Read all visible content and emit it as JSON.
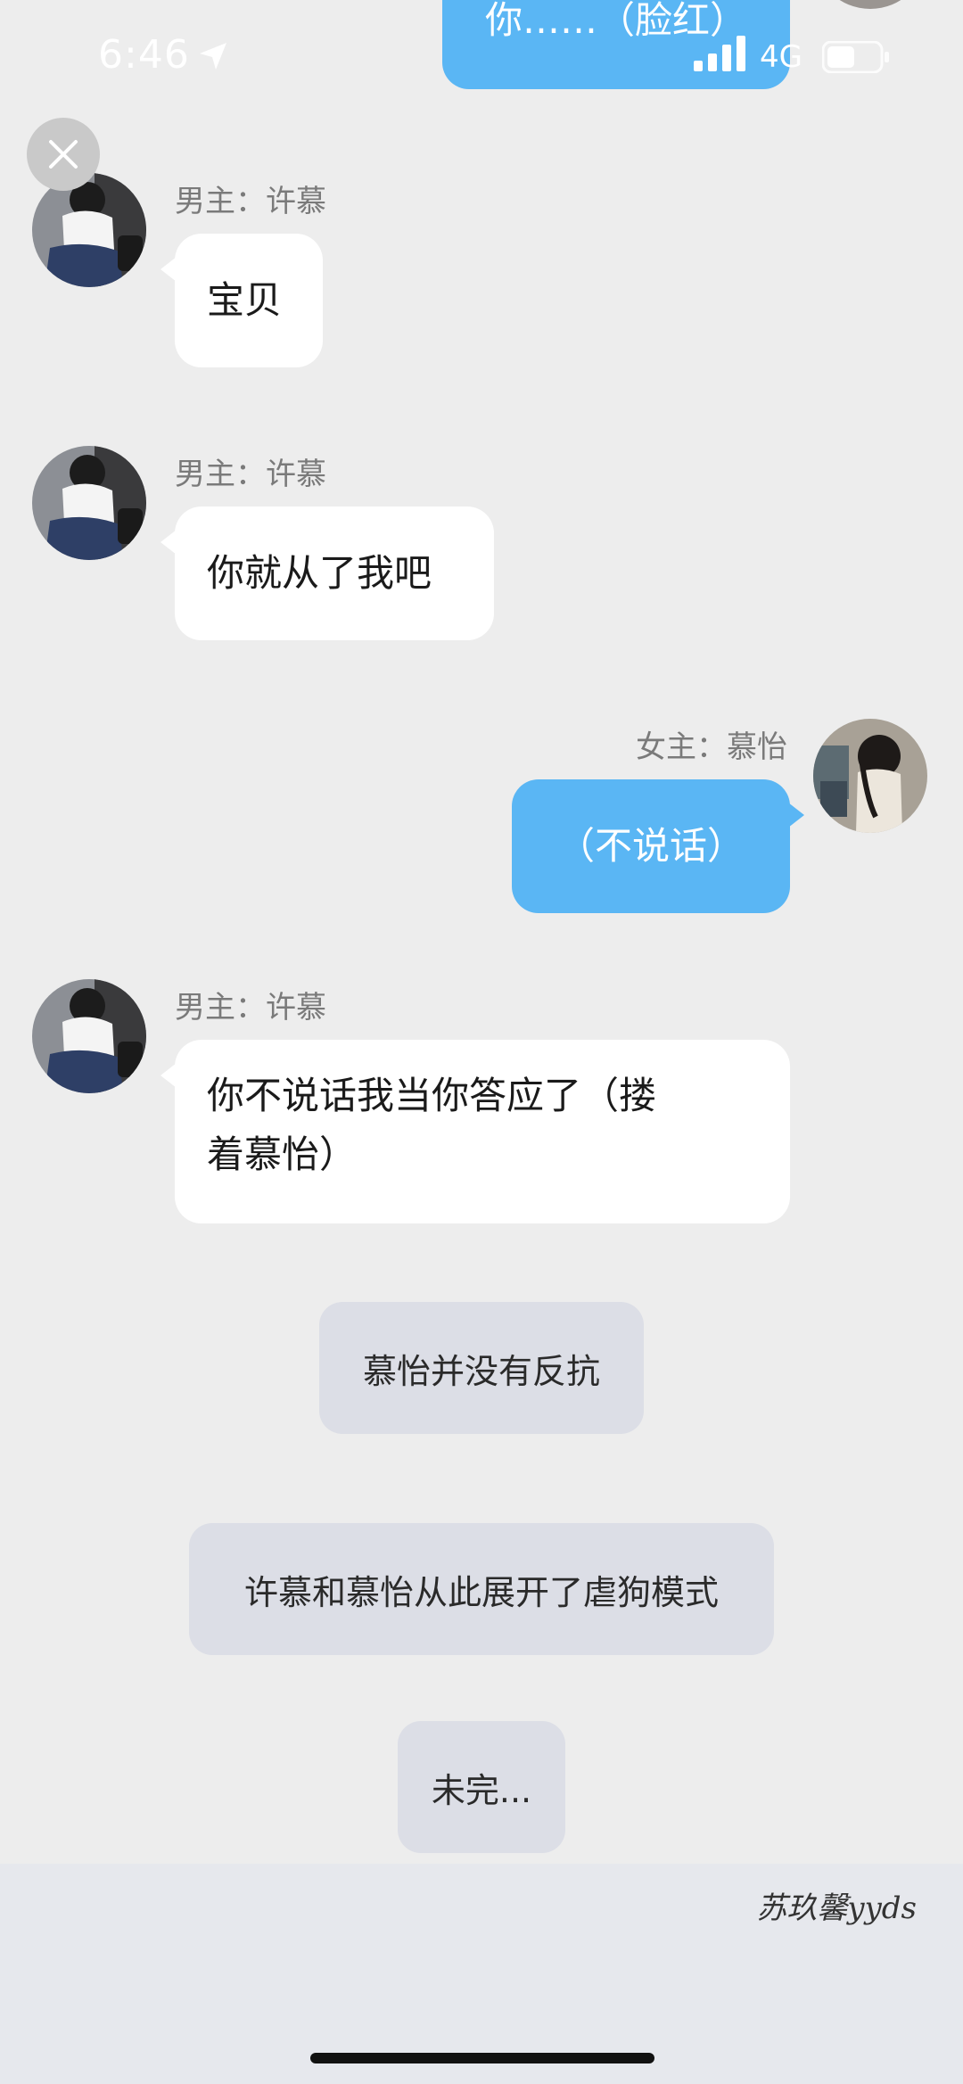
{
  "status_bar": {
    "time": "6:46",
    "network": "4G"
  },
  "messages": {
    "top_partial": {
      "text": "你……（脸红）"
    },
    "m1": {
      "sender": "男主：许慕",
      "text": "宝贝"
    },
    "m2": {
      "sender": "男主：许慕",
      "text": "你就从了我吧"
    },
    "m3": {
      "sender": "女主：慕怡",
      "text": "（不说话）"
    },
    "m4": {
      "sender": "男主：许慕",
      "line1": "你不说话我当你答应了（搂",
      "line2": "着慕怡）"
    }
  },
  "system": [
    {
      "text": "慕怡并没有反抗"
    },
    {
      "text": "许慕和慕怡从此展开了虐狗模式"
    },
    {
      "text": "未完..."
    }
  ],
  "watermark": "苏玖馨yyds",
  "colors": {
    "bubble_blue": "#5ab6f4",
    "background": "#ededed",
    "system_bubble": "#dcdee6"
  }
}
